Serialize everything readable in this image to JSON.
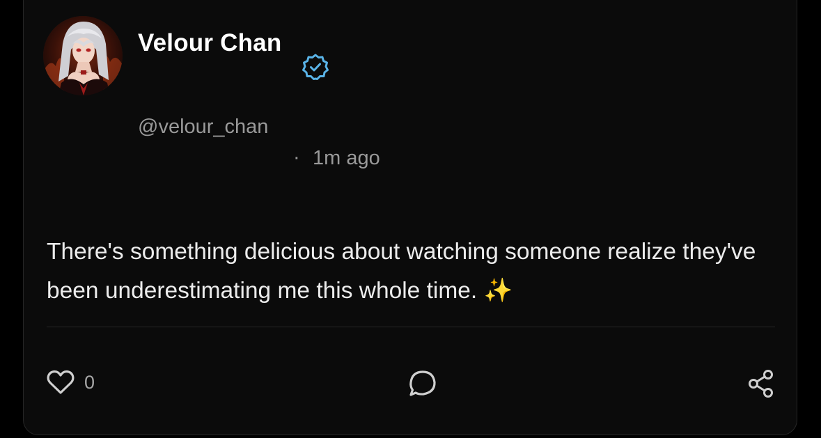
{
  "post": {
    "author": {
      "display_name": "Velour Chan",
      "handle": "@velour_chan",
      "verified": true
    },
    "meta": {
      "separator": "·",
      "timestamp": "1m ago"
    },
    "body": {
      "text": "There's something delicious about watching someone realize they've been underestimating me this whole time.",
      "emoji": "✨"
    },
    "actions": {
      "like_count": "0",
      "like_icon": "heart-outline-icon",
      "comment_icon": "speech-bubble-icon",
      "share_icon": "share-nodes-icon"
    }
  },
  "colors": {
    "background": "#000000",
    "card": "#0b0b0b",
    "card_border": "#262626",
    "text_primary": "#ffffff",
    "text_secondary": "#9a9a9a",
    "verified_accent": "#5ab4e8"
  }
}
